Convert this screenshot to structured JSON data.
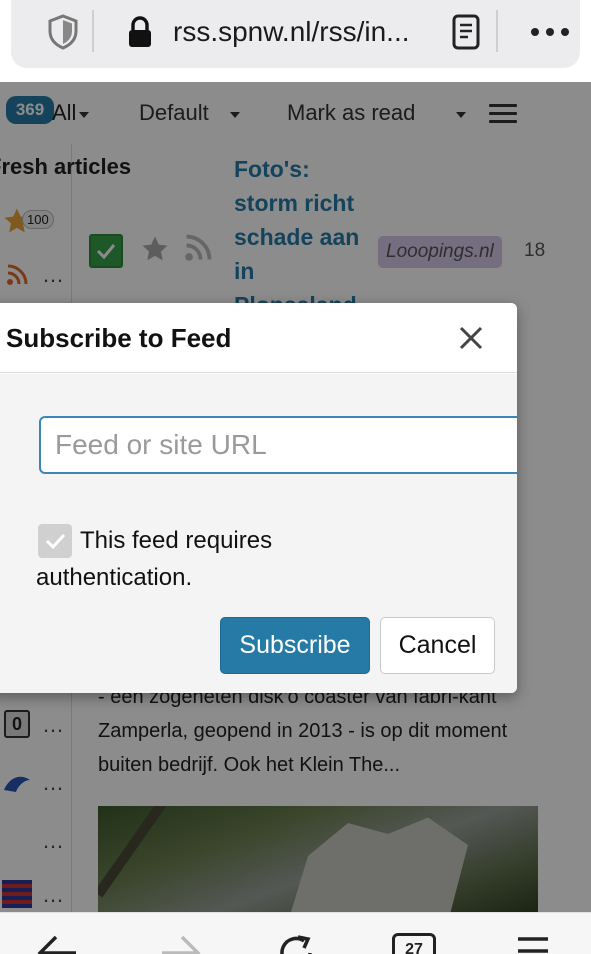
{
  "browser": {
    "url": "rss.spnw.nl/rss/in...",
    "icons": [
      "shield-icon",
      "lock-icon",
      "reader-mode-icon",
      "more-dots-icon"
    ],
    "bottom_bar": {
      "tab_count": "27",
      "icons": [
        "back-arrow-icon",
        "forward-arrow-icon",
        "reload-icon",
        "tabs-icon",
        "menu-icon"
      ]
    }
  },
  "toolbar": {
    "unread_count": "369",
    "view_mode": "All",
    "sort_mode": "Default",
    "mark_as_read": "Mark as read"
  },
  "sidebar": {
    "heading": "Fresh articles",
    "starred_count": "100",
    "ellipsis": "…"
  },
  "article": {
    "title": "Foto's: storm richt schade aan in Plopsaland",
    "feed": "Looopings.nl",
    "date": "18",
    "excerpt": "- een zogeheten disk'o coaster van fabri-kant Zamperla, geopend in 2013 - is op dit moment buiten bedrijf. Ook het Klein The..."
  },
  "dialog": {
    "title": "Subscribe to Feed",
    "url_placeholder": "Feed or site URL",
    "url_value": "",
    "auth_label": "This feed requires authentication.",
    "auth_checked": true,
    "subscribe_label": "Subscribe",
    "cancel_label": "Cancel"
  },
  "colors": {
    "accent": "#257aa6",
    "feed_tag": "#d6c9ec",
    "checkbox_green": "#3aa04a"
  }
}
